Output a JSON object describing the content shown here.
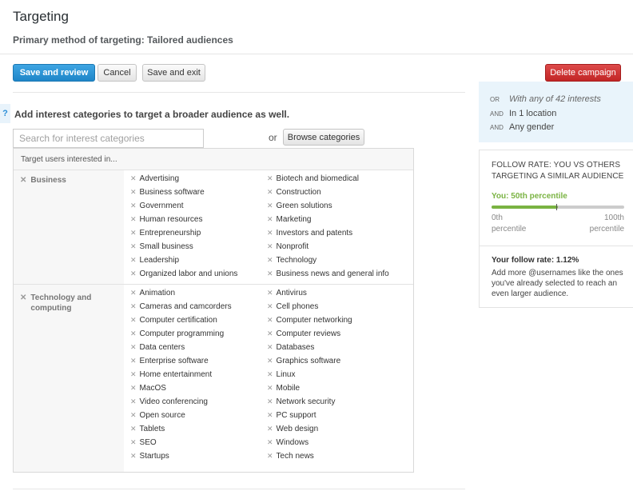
{
  "header": {
    "title": "Targeting",
    "subtitle": "Primary method of targeting: Tailored audiences"
  },
  "toolbar": {
    "save_review": "Save and review",
    "cancel": "Cancel",
    "save_exit": "Save and exit",
    "delete": "Delete campaign"
  },
  "interests": {
    "help_icon": "?",
    "heading": "Add interest categories to target a broader audience as well.",
    "search_placeholder": "Search for interest categories",
    "or_text": "or",
    "browse_label": "Browse categories",
    "panel_header": "Target users interested in...",
    "remove_glyph": "✕",
    "categories": [
      {
        "name": "Business",
        "col1": [
          "Advertising",
          "Business software",
          "Government",
          "Human resources",
          "Entrepreneurship",
          "Small business",
          "Leadership",
          "Organized labor and unions"
        ],
        "col2": [
          "Biotech and biomedical",
          "Construction",
          "Green solutions",
          "Marketing",
          "Investors and patents",
          "Nonprofit",
          "Technology",
          "Business news and general info"
        ]
      },
      {
        "name": "Technology and computing",
        "col1": [
          "Animation",
          "Cameras and camcorders",
          "Computer certification",
          "Computer programming",
          "Data centers",
          "Enterprise software",
          "Home entertainment",
          "MacOS",
          "Video conferencing",
          "Open source",
          "Tablets",
          "SEO",
          "Startups"
        ],
        "col2": [
          "Antivirus",
          "Cell phones",
          "Computer networking",
          "Computer reviews",
          "Databases",
          "Graphics software",
          "Linux",
          "Mobile",
          "Network security",
          "PC support",
          "Web design",
          "Windows",
          "Tech news"
        ]
      }
    ]
  },
  "summary": {
    "rows": [
      {
        "conj": "OR",
        "text": "With any of 42 interests",
        "italic": true
      },
      {
        "conj": "AND",
        "text": "In 1 location",
        "italic": false
      },
      {
        "conj": "AND",
        "text": "Any gender",
        "italic": false
      }
    ]
  },
  "follow_rate": {
    "title": "FOLLOW RATE: YOU VS OTHERS TARGETING A SIMILAR AUDIENCE",
    "you_label": "You: 50th percentile",
    "percentile": 50,
    "min_label": "0th percentile",
    "max_label": "100th percentile",
    "rate_label": "Your follow rate: 1.12%",
    "description": "Add more @usernames like the ones you've already selected to reach an even larger audience.",
    "colors": {
      "fill": "#7ab342",
      "track": "#cccccc"
    }
  }
}
